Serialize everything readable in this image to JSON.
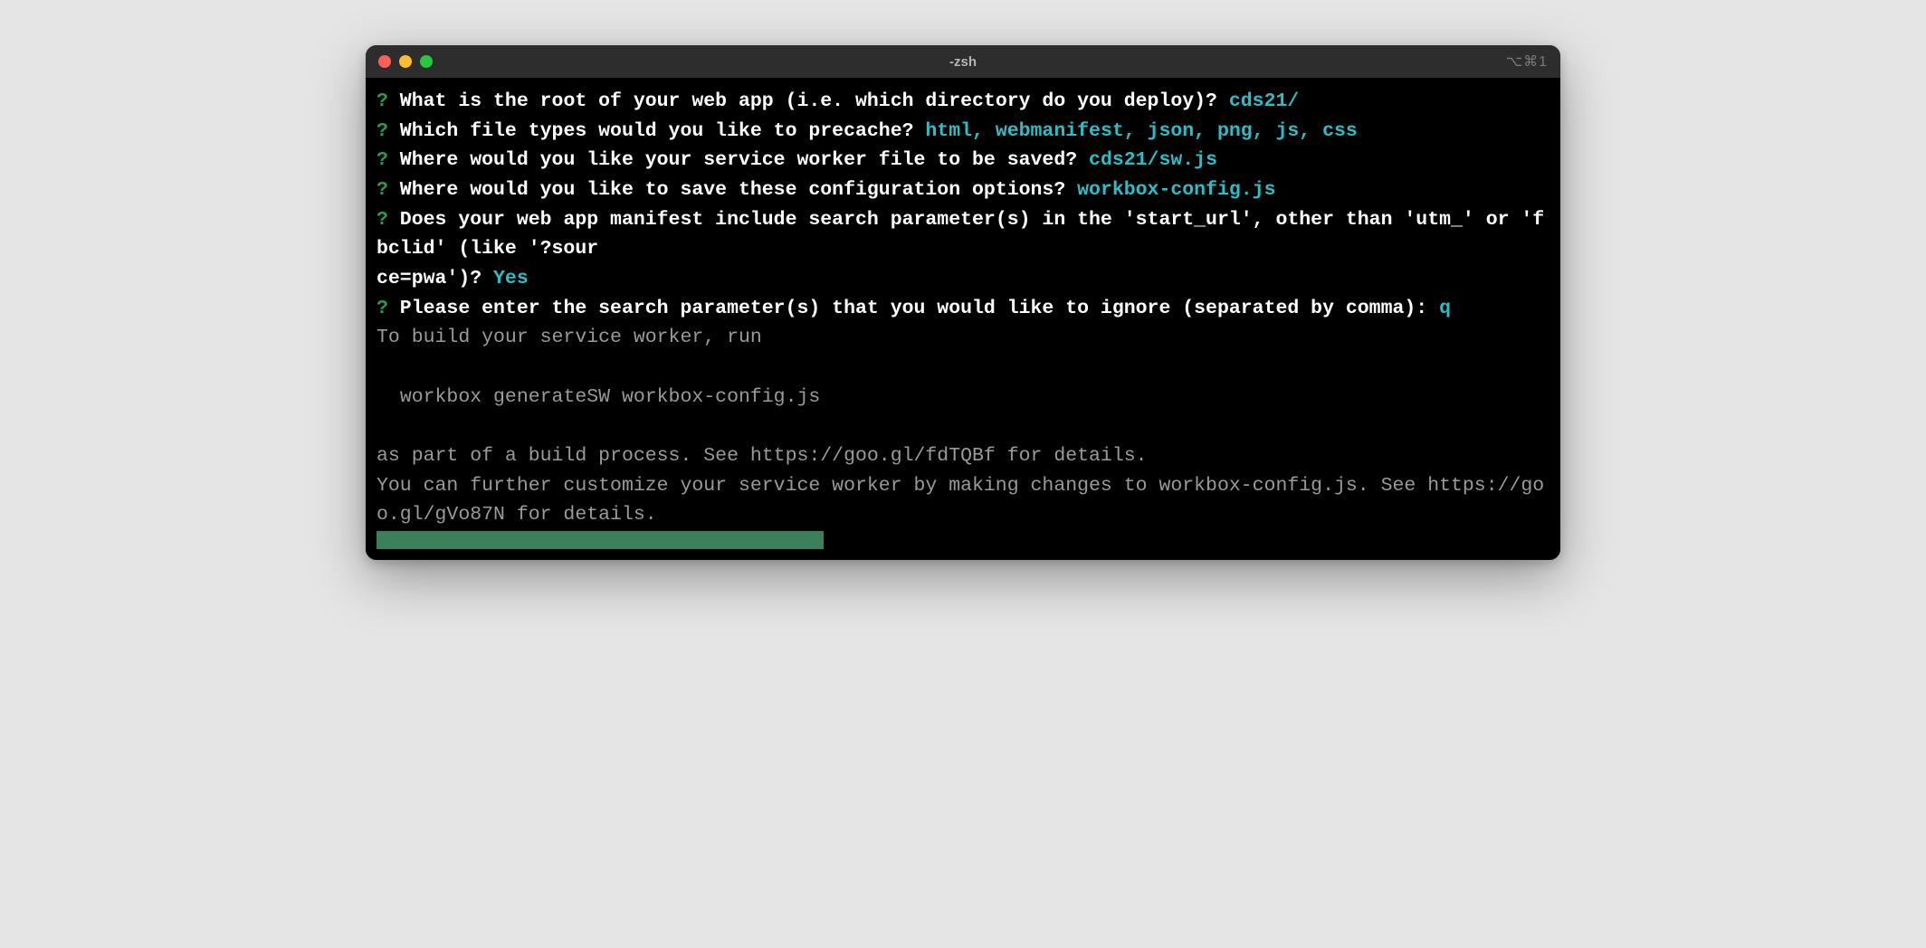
{
  "window": {
    "title": "-zsh",
    "right_indicator": "⌥⌘1"
  },
  "prompts": [
    {
      "mark": "?",
      "question": " What is the root of your web app (i.e. which directory do you deploy)? ",
      "answer": "cds21/"
    },
    {
      "mark": "?",
      "question": " Which file types would you like to precache? ",
      "answer": "html, webmanifest, json, png, js, css"
    },
    {
      "mark": "?",
      "question": " Where would you like your service worker file to be saved? ",
      "answer": "cds21/sw.js"
    },
    {
      "mark": "?",
      "question": " Where would you like to save these configuration options? ",
      "answer": "workbox-config.js"
    },
    {
      "mark": "?",
      "question": " Does your web app manifest include search parameter(s) in the 'start_url', other than 'utm_' or 'fbclid' (like '?sour\nce=pwa')? ",
      "answer": "Yes"
    },
    {
      "mark": "?",
      "question": " Please enter the search parameter(s) that you would like to ignore (separated by comma): ",
      "answer": "q"
    }
  ],
  "info_lines": "To build your service worker, run\n\n  workbox generateSW workbox-config.js\n\nas part of a build process. See https://goo.gl/fdTQBf for details.\nYou can further customize your service worker by making changes to workbox-config.js. See https://goo.gl/gVo87N for details."
}
